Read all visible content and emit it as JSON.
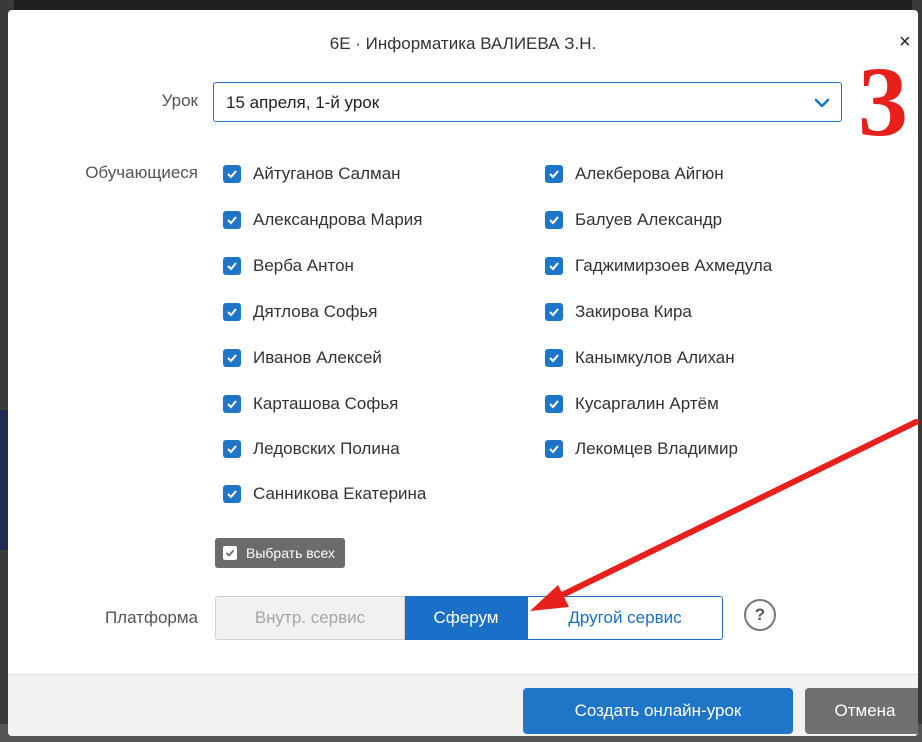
{
  "dialog": {
    "title": "6Е · Информатика ВАЛИЕВА З.Н.",
    "close_glyph": "×"
  },
  "lesson": {
    "label": "Урок",
    "value": "15 апреля, 1-й урок"
  },
  "students": {
    "label": "Обучающиеся",
    "left": [
      {
        "name": "Айтуганов Салман",
        "checked": true
      },
      {
        "name": "Александрова Мария",
        "checked": true
      },
      {
        "name": "Верба Антон",
        "checked": true
      },
      {
        "name": "Дятлова Софья",
        "checked": true
      },
      {
        "name": "Иванов Алексей",
        "checked": true
      },
      {
        "name": "Карташова Софья",
        "checked": true
      },
      {
        "name": "Ледовских Полина",
        "checked": true
      },
      {
        "name": "Санникова Екатерина",
        "checked": true
      }
    ],
    "right": [
      {
        "name": "Алекберова Айгюн",
        "checked": true
      },
      {
        "name": "Балуев Александр",
        "checked": true
      },
      {
        "name": "Гаджимирзоев Ахмедула",
        "checked": true
      },
      {
        "name": "Закирова Кира",
        "checked": true
      },
      {
        "name": "Канымкулов Алихан",
        "checked": true
      },
      {
        "name": "Кусаргалин Артём",
        "checked": true
      },
      {
        "name": "Лекомцев Владимир",
        "checked": true
      }
    ],
    "select_all_label": "Выбрать всех"
  },
  "platform": {
    "label": "Платформа",
    "options": [
      "Внутр. сервис",
      "Сферум",
      "Другой сервис"
    ],
    "selected": "Сферум",
    "help_glyph": "?"
  },
  "footer": {
    "create_label": "Создать онлайн-урок",
    "cancel_label": "Отмена"
  },
  "annotation": {
    "step_number": "3",
    "color": "#e8201c"
  },
  "colors": {
    "accent": "#1f76c9",
    "cancel": "#707070"
  }
}
